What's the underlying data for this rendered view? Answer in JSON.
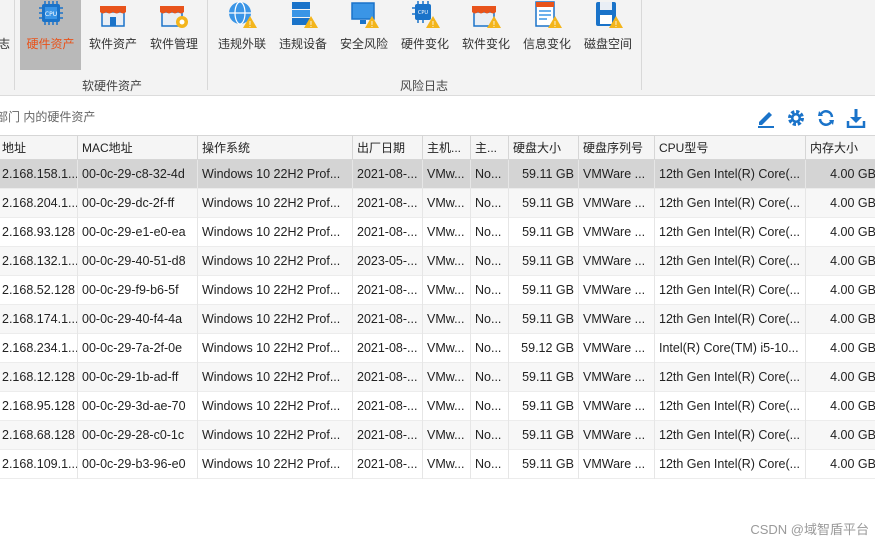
{
  "ribbon": {
    "cut_label": "志",
    "hardware_assets": "硬件资产",
    "software_assets": "软件资产",
    "software_management": "软件管理",
    "group_assets": "软硬件资产",
    "violation_external": "违规外联",
    "violation_device": "违规设备",
    "security_risk": "安全风险",
    "hardware_change": "硬件变化",
    "software_change": "软件变化",
    "info_change": "信息变化",
    "disk_space": "磁盘空间",
    "group_risk_log": "风险日志"
  },
  "scope": {
    "text": "部门 内的硬件资产"
  },
  "colors": {
    "accent_orange": "#e8531b",
    "accent_blue": "#1a73c9",
    "warning_yellow": "#f3b51c"
  },
  "table": {
    "headers": [
      "地址",
      "MAC地址",
      "操作系统",
      "出厂日期",
      "主机...",
      "主...",
      "硬盘大小",
      "硬盘序列号",
      "CPU型号",
      "内存大小"
    ],
    "rows": [
      [
        "2.168.158.1...",
        "00-0c-29-c8-32-4d",
        "Windows 10 22H2 Prof...",
        "2021-08-...",
        "VMw...",
        "No...",
        "59.11 GB",
        "VMWare ...",
        "12th Gen Intel(R) Core(...",
        "4.00 GB"
      ],
      [
        "2.168.204.1...",
        "00-0c-29-dc-2f-ff",
        "Windows 10 22H2 Prof...",
        "2021-08-...",
        "VMw...",
        "No...",
        "59.11 GB",
        "VMWare ...",
        "12th Gen Intel(R) Core(...",
        "4.00 GB"
      ],
      [
        "2.168.93.128",
        "00-0c-29-e1-e0-ea",
        "Windows 10 22H2 Prof...",
        "2021-08-...",
        "VMw...",
        "No...",
        "59.11 GB",
        "VMWare ...",
        "12th Gen Intel(R) Core(...",
        "4.00 GB"
      ],
      [
        "2.168.132.1...",
        "00-0c-29-40-51-d8",
        "Windows 10 22H2 Prof...",
        "2023-05-...",
        "VMw...",
        "No...",
        "59.11 GB",
        "VMWare ...",
        "12th Gen Intel(R) Core(...",
        "4.00 GB"
      ],
      [
        "2.168.52.128",
        "00-0c-29-f9-b6-5f",
        "Windows 10 22H2 Prof...",
        "2021-08-...",
        "VMw...",
        "No...",
        "59.11 GB",
        "VMWare ...",
        "12th Gen Intel(R) Core(...",
        "4.00 GB"
      ],
      [
        "2.168.174.1...",
        "00-0c-29-40-f4-4a",
        "Windows 10 22H2 Prof...",
        "2021-08-...",
        "VMw...",
        "No...",
        "59.11 GB",
        "VMWare ...",
        "12th Gen Intel(R) Core(...",
        "4.00 GB"
      ],
      [
        "2.168.234.1...",
        "00-0c-29-7a-2f-0e",
        "Windows 10 22H2 Prof...",
        "2021-08-...",
        "VMw...",
        "No...",
        "59.12 GB",
        "VMWare ...",
        "Intel(R) Core(TM) i5-10...",
        "4.00 GB"
      ],
      [
        "2.168.12.128",
        "00-0c-29-1b-ad-ff",
        "Windows 10 22H2 Prof...",
        "2021-08-...",
        "VMw...",
        "No...",
        "59.11 GB",
        "VMWare ...",
        "12th Gen Intel(R) Core(...",
        "4.00 GB"
      ],
      [
        "2.168.95.128",
        "00-0c-29-3d-ae-70",
        "Windows 10 22H2 Prof...",
        "2021-08-...",
        "VMw...",
        "No...",
        "59.11 GB",
        "VMWare ...",
        "12th Gen Intel(R) Core(...",
        "4.00 GB"
      ],
      [
        "2.168.68.128",
        "00-0c-29-28-c0-1c",
        "Windows 10 22H2 Prof...",
        "2021-08-...",
        "VMw...",
        "No...",
        "59.11 GB",
        "VMWare ...",
        "12th Gen Intel(R) Core(...",
        "4.00 GB"
      ],
      [
        "2.168.109.1...",
        "00-0c-29-b3-96-e0",
        "Windows 10 22H2 Prof...",
        "2021-08-...",
        "VMw...",
        "No...",
        "59.11 GB",
        "VMWare ...",
        "12th Gen Intel(R) Core(...",
        "4.00 GB"
      ]
    ]
  },
  "watermark": "CSDN @域智盾平台"
}
